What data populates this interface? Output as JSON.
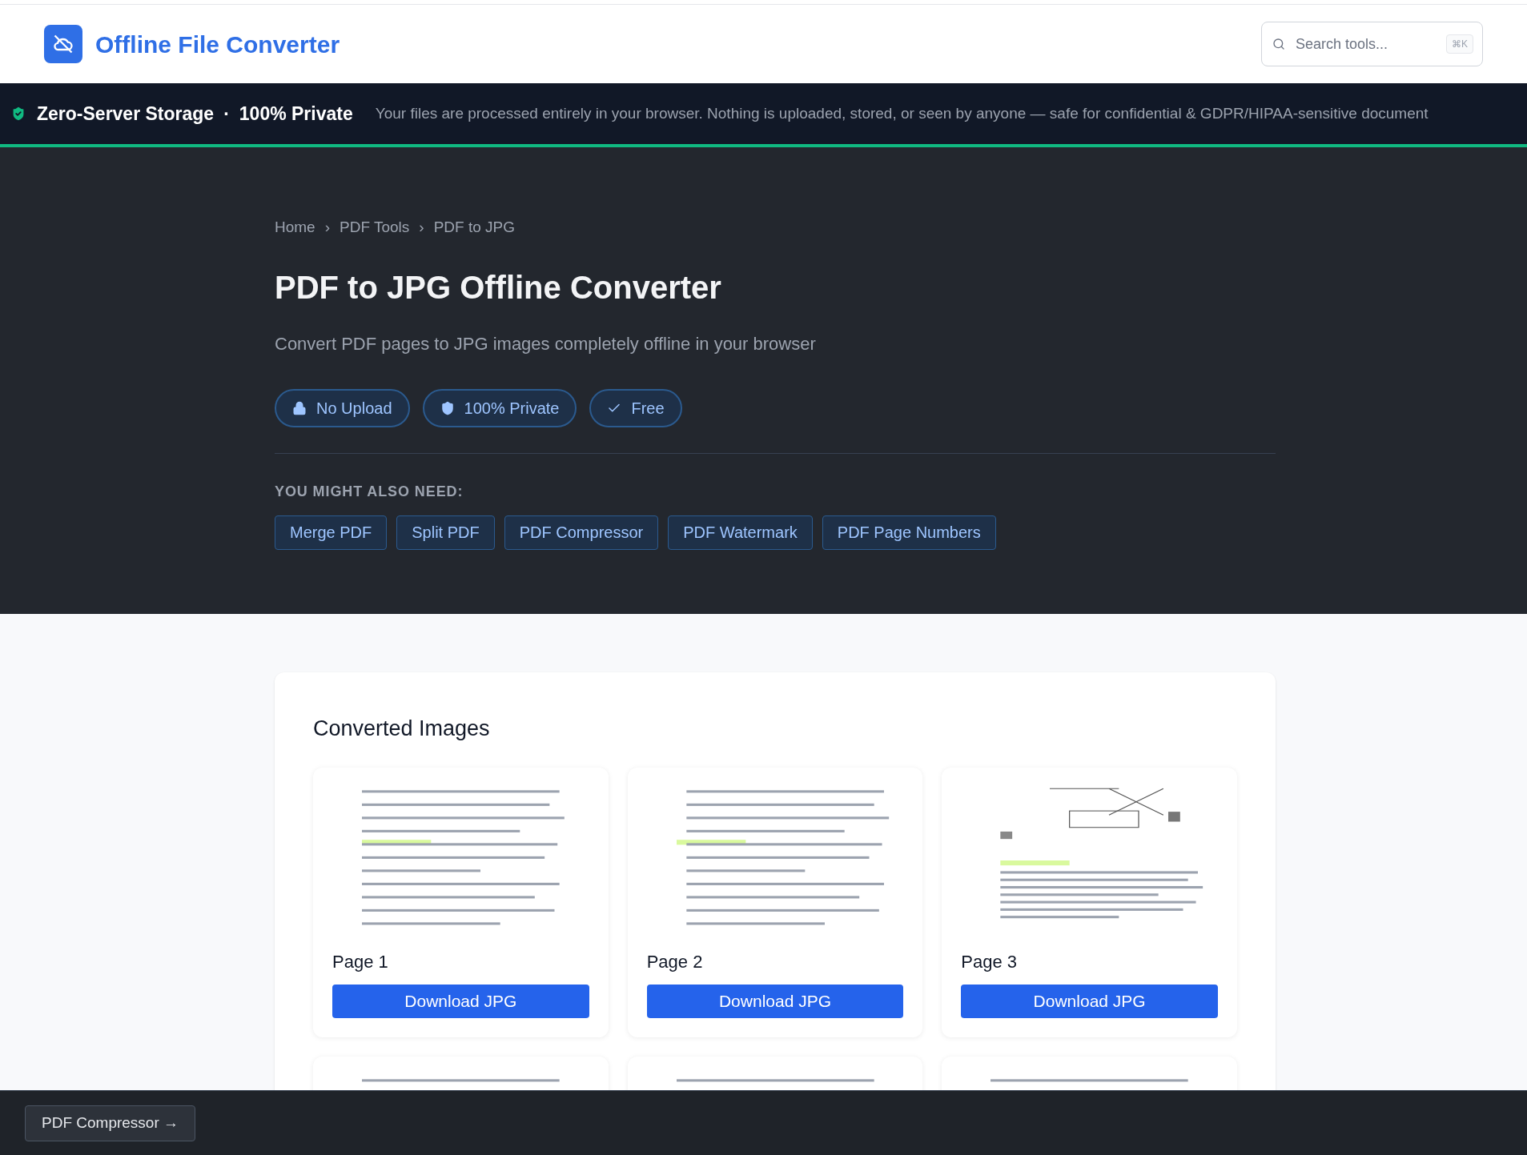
{
  "header": {
    "app_name": "Offline File Converter",
    "search": {
      "placeholder": "Search tools...",
      "shortcut": "⌘K"
    }
  },
  "banner": {
    "title": "Zero-Server Storage",
    "separator": "·",
    "highlight": "100% Private",
    "message": "Your files are processed entirely in your browser. Nothing is uploaded, stored, or seen by anyone — safe for confidential & GDPR/HIPAA-sensitive document"
  },
  "breadcrumb": [
    {
      "label": "Home"
    },
    {
      "label": "PDF Tools"
    },
    {
      "label": "PDF to JPG"
    }
  ],
  "breadcrumb_separator": "›",
  "hero": {
    "title": "PDF to JPG Offline Converter",
    "subtitle": "Convert PDF pages to JPG images completely offline in your browser",
    "badges": [
      {
        "kind": "lock",
        "label": "No Upload"
      },
      {
        "kind": "shield",
        "label": "100% Private"
      },
      {
        "kind": "check",
        "label": "Free"
      }
    ]
  },
  "related": {
    "heading": "YOU MIGHT ALSO NEED:",
    "tools": [
      "Merge PDF",
      "Split PDF",
      "PDF Compressor",
      "PDF Watermark",
      "PDF Page Numbers"
    ]
  },
  "results": {
    "title": "Converted Images",
    "pages": [
      {
        "kind": "picture",
        "label": "Page 1",
        "button": "Download JPG"
      },
      {
        "kind": "picture",
        "label": "Page 2",
        "button": "Download JPG"
      },
      {
        "kind": "picture",
        "label": "Page 3",
        "button": "Download JPG"
      }
    ]
  },
  "bottom_bar": {
    "button": "PDF Compressor →"
  }
}
